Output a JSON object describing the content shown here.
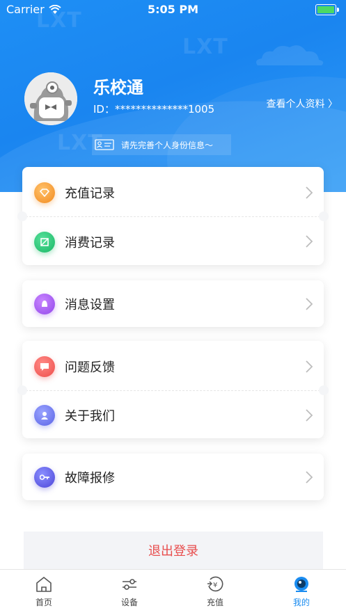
{
  "status_bar": {
    "carrier": "Carrier",
    "time": "5:05 PM"
  },
  "header": {
    "watermark": "LXT"
  },
  "profile": {
    "name": "乐校通",
    "id_text": "ID：**************1005",
    "view_profile": "查看个人资料 〉",
    "verify_prompt": "请先完善个人身份信息～"
  },
  "menu": {
    "recharge_records": "充值记录",
    "consumption_records": "消费记录",
    "message_settings": "消息设置",
    "feedback": "问题反馈",
    "about_us": "关于我们",
    "repair": "故障报修"
  },
  "logout": "退出登录",
  "tabs": {
    "home": "首页",
    "devices": "设备",
    "recharge": "充值",
    "mine": "我的"
  },
  "colors": {
    "primary": "#1a8cf0",
    "danger": "#e84d4d"
  }
}
